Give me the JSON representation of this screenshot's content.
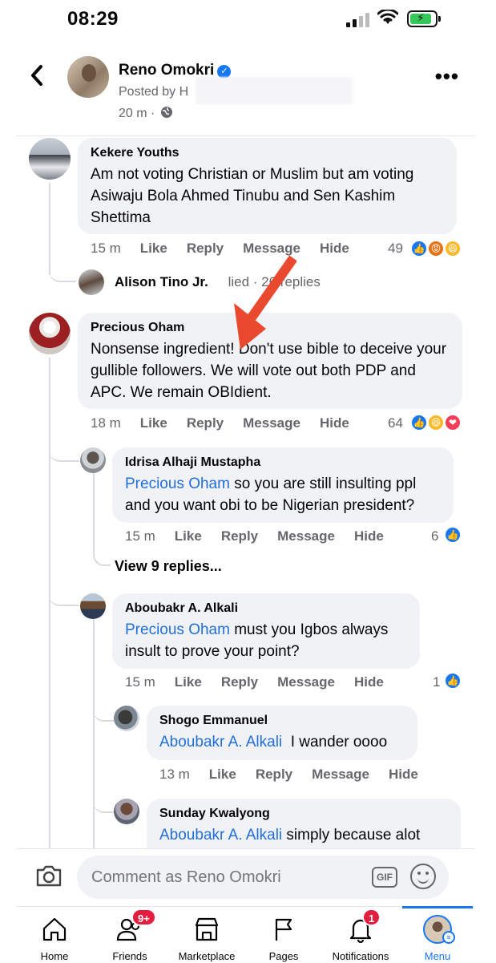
{
  "status": {
    "time": "08:29"
  },
  "post_header": {
    "page_name": "Reno Omokri",
    "posted_by": "Posted by H",
    "time": "20 m ·"
  },
  "comments": [
    {
      "author": "Kekere Youths",
      "text": "Am not voting Christian or Muslim but am voting Asiwaju Bola Ahmed Tinubu and Sen Kashim Shettima",
      "time": "15 m",
      "reaction_count": "49"
    },
    {
      "author": "Precious Oham",
      "text": "Nonsense ingredient! Don't use bible to deceive your gullible followers. We will vote out both PDP and APC. We remain OBIdient.",
      "time": "18 m",
      "reaction_count": "64"
    },
    {
      "author": "Idrisa Alhaji Mustapha",
      "mention": "Precious Oham",
      "text": " so you are still insulting ppl and you want obi to be Nigerian president?",
      "time": "15 m",
      "reaction_count": "6"
    },
    {
      "author": "Aboubakr A. Alkali",
      "mention": "Precious Oham",
      "text": " must you Igbos always insult to prove your point?",
      "time": "15 m",
      "reaction_count": "1"
    },
    {
      "author": "Shogo Emmanuel",
      "mention": "Aboubakr A. Alkali",
      "text": "  I wander oooo",
      "time": "13 m"
    },
    {
      "author": "Sunday Kwalyong",
      "mention": "Aboubakr A. Alkali",
      "text": " simply because alot"
    }
  ],
  "actions": {
    "like": "Like",
    "reply": "Reply",
    "message": "Message",
    "hide": "Hide"
  },
  "reply_summary": {
    "name": "Alison Tino Jr.",
    "replied": "lied",
    "count": "· 26 replies"
  },
  "view_replies": "View 9 replies...",
  "composer": {
    "placeholder": "Comment as Reno Omokri",
    "gif": "GIF"
  },
  "tabs": [
    {
      "label": "Home"
    },
    {
      "label": "Friends",
      "badge": "9+"
    },
    {
      "label": "Marketplace"
    },
    {
      "label": "Pages"
    },
    {
      "label": "Notifications",
      "badge": "1"
    },
    {
      "label": "Menu"
    }
  ],
  "colors": {
    "accent": "#1877f2",
    "mention": "#216fdb",
    "arrow": "#e8492f",
    "badge": "#e41e3f"
  },
  "icons": [
    "back-icon",
    "verified-icon",
    "globe-icon",
    "more-icon",
    "camera-icon",
    "gif-icon",
    "emoji-icon",
    "home-icon",
    "friends-icon",
    "marketplace-icon",
    "pages-icon",
    "notifications-icon",
    "menu-icon"
  ]
}
